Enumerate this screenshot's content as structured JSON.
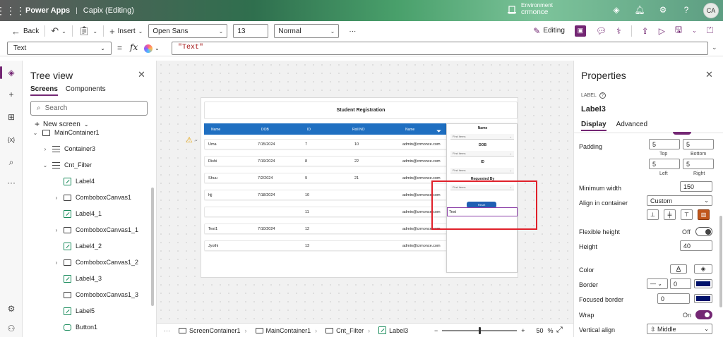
{
  "header": {
    "app_name": "Power Apps",
    "separator": "|",
    "document_title": "Capix (Editing)",
    "environment_label": "Environment",
    "environment_value": "crmonce",
    "avatar_initials": "CA"
  },
  "commandbar": {
    "back": "Back",
    "insert": "Insert",
    "font": "Open Sans",
    "font_size": "13",
    "font_weight": "Normal",
    "more": "···",
    "editing": "Editing"
  },
  "formula": {
    "property": "Text",
    "equals": "=",
    "fx": "fx",
    "value": "\"Text\""
  },
  "tree": {
    "title": "Tree view",
    "tab_screens": "Screens",
    "tab_components": "Components",
    "search_placeholder": "Search",
    "new_screen": "New screen",
    "items": [
      {
        "label": "MainContainer1"
      },
      {
        "label": "Container3"
      },
      {
        "label": "Cnt_Filter"
      },
      {
        "label": "Label4"
      },
      {
        "label": "ComboboxCanvas1"
      },
      {
        "label": "Label4_1"
      },
      {
        "label": "ComboboxCanvas1_1"
      },
      {
        "label": "Label4_2"
      },
      {
        "label": "ComboboxCanvas1_2"
      },
      {
        "label": "Label4_3"
      },
      {
        "label": "ComboboxCanvas1_3"
      },
      {
        "label": "Label5"
      },
      {
        "label": "Button1"
      }
    ]
  },
  "canvas": {
    "header_title": "Student Registration",
    "columns": [
      "Name",
      "DOB",
      "ID",
      "Roll NO",
      "Name"
    ],
    "rows": [
      {
        "name": "Uma",
        "dob": "7/15/2024",
        "id": "7",
        "roll": "10",
        "email": "admin@crmonce.com"
      },
      {
        "name": "Rishi",
        "dob": "7/19/2024",
        "id": "8",
        "roll": "22",
        "email": "admin@crmonce.com"
      },
      {
        "name": "Shuu",
        "dob": "7/2/2024",
        "id": "9",
        "roll": "21",
        "email": "admin@crmonce.com"
      },
      {
        "name": "hjj",
        "dob": "7/18/2024",
        "id": "10",
        "roll": "",
        "email": "admin@crmonce.com"
      },
      {
        "name": "",
        "dob": "",
        "id": "11",
        "roll": "",
        "email": "admin@crmonce.com"
      },
      {
        "name": "Test1",
        "dob": "7/10/2024",
        "id": "12",
        "roll": "",
        "email": "admin@crmonce.com"
      },
      {
        "name": "Jyothi",
        "dob": "",
        "id": "13",
        "roll": "",
        "email": "admin@crmonce.com"
      }
    ],
    "filter": {
      "name_label": "Name",
      "dob_label": "DOB",
      "id_label": "ID",
      "requested_label": "Requested By",
      "find_items": "Find items",
      "reset": "Reset",
      "text_label": "Text"
    }
  },
  "status": {
    "more": "···",
    "crumbs": [
      "ScreenContainer1",
      "MainContainer1",
      "Cnt_Filter",
      "Label3"
    ],
    "zoom_minus": "−",
    "zoom_plus": "+",
    "zoom_value": "50",
    "zoom_unit": "%"
  },
  "properties": {
    "title": "Properties",
    "control_type": "LABEL",
    "control_name": "Label3",
    "tab_display": "Display",
    "tab_advanced": "Advanced",
    "padding_label": "Padding",
    "padding_top": "5",
    "padding_bottom": "5",
    "padding_left": "5",
    "padding_right": "5",
    "top_label": "Top",
    "bottom_label": "Bottom",
    "left_label": "Left",
    "right_label": "Right",
    "min_width_label": "Minimum width",
    "min_width_value": "150",
    "align_label": "Align in container",
    "align_value": "Custom",
    "flex_height_label": "Flexible height",
    "flex_height_state": "Off",
    "height_label": "Height",
    "height_value": "40",
    "color_label": "Color",
    "border_label": "Border",
    "border_value": "0",
    "focused_border_label": "Focused border",
    "focused_border_value": "0",
    "wrap_label": "Wrap",
    "wrap_state": "On",
    "vertical_align_label": "Vertical align",
    "vertical_align_value": "Middle",
    "border_color": "#00126b",
    "focused_border_color": "#00126b"
  },
  "colors": {
    "accent": "#742774",
    "grid_header": "#1f6fc1",
    "highlight_box": "#e0202a",
    "selection": "#8b3fa8"
  }
}
